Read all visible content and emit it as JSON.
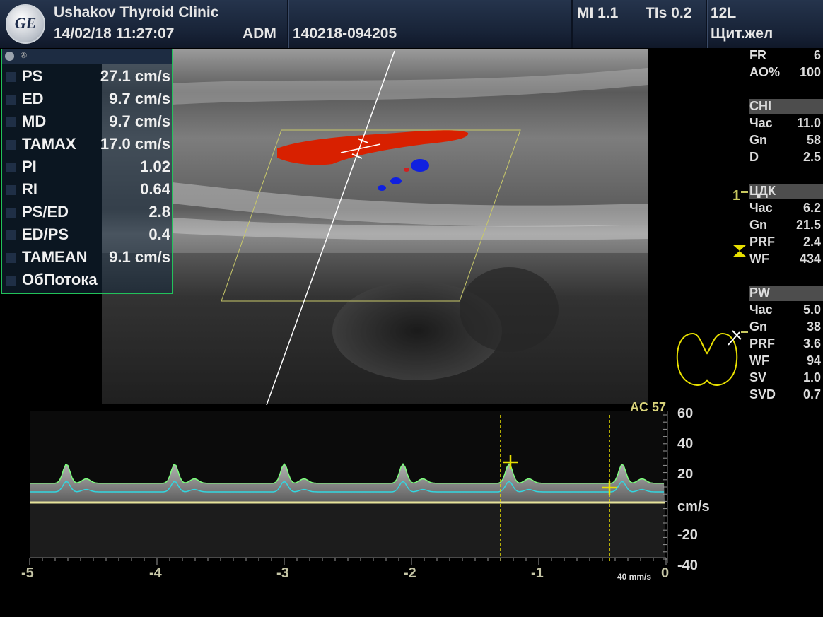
{
  "header": {
    "clinic": "Ushakov Thyroid Clinic",
    "datetime": "14/02/18 11:27:07",
    "operator": "ADM",
    "study_id": "140218-094205",
    "mi": "MI 1.1",
    "tis": "TIs 0.2",
    "probe": "12L",
    "preset": "Щит.жел",
    "logo": "GE"
  },
  "measurements": [
    {
      "label": "PS",
      "value": "27.1 cm/s"
    },
    {
      "label": "ED",
      "value": "9.7 cm/s"
    },
    {
      "label": "MD",
      "value": "9.7 cm/s"
    },
    {
      "label": "TAMAX",
      "value": "17.0 cm/s"
    },
    {
      "label": "PI",
      "value": "1.02"
    },
    {
      "label": "RI",
      "value": "0.64"
    },
    {
      "label": "PS/ED",
      "value": "2.8"
    },
    {
      "label": "ED/PS",
      "value": "0.4"
    },
    {
      "label": "TAMEAN",
      "value": "9.1 cm/s"
    },
    {
      "label": "ОбПотока",
      "value": ""
    }
  ],
  "params_top": [
    {
      "key": "FR",
      "value": "6"
    },
    {
      "key": "AO%",
      "value": "100"
    }
  ],
  "chi": {
    "title": "CHI",
    "items": [
      {
        "key": "Час",
        "value": "11.0"
      },
      {
        "key": "Gn",
        "value": "58"
      },
      {
        "key": "D",
        "value": "2.5"
      }
    ]
  },
  "cdk": {
    "title": "ЦДК",
    "items": [
      {
        "key": "Час",
        "value": "6.2"
      },
      {
        "key": "Gn",
        "value": "21.5"
      },
      {
        "key": "PRF",
        "value": "2.4"
      },
      {
        "key": "WF",
        "value": "434"
      }
    ]
  },
  "pw": {
    "title": "PW",
    "items": [
      {
        "key": "Час",
        "value": "5.0"
      },
      {
        "key": "Gn",
        "value": "38"
      },
      {
        "key": "PRF",
        "value": "3.6"
      },
      {
        "key": "WF",
        "value": "94"
      },
      {
        "key": "SV",
        "value": "1.0"
      },
      {
        "key": "SVD",
        "value": "0.7"
      }
    ]
  },
  "focus_marker": "1",
  "spectral": {
    "ac_label": "AC 57",
    "unit": "cm/s",
    "sweep_speed": "40 mm/s",
    "y_ticks": [
      "60",
      "40",
      "20",
      "-20",
      "-40"
    ],
    "x_ticks": [
      "-5",
      "-4",
      "-3",
      "-2",
      "-1",
      "0"
    ]
  },
  "colors": {
    "panel_border": "#22c25a",
    "caliper": "#e8e000",
    "envelope_max": "#7cff7c",
    "envelope_mean": "#33d6e0",
    "doppler_red": "#d82000",
    "doppler_blue": "#1020e0"
  }
}
